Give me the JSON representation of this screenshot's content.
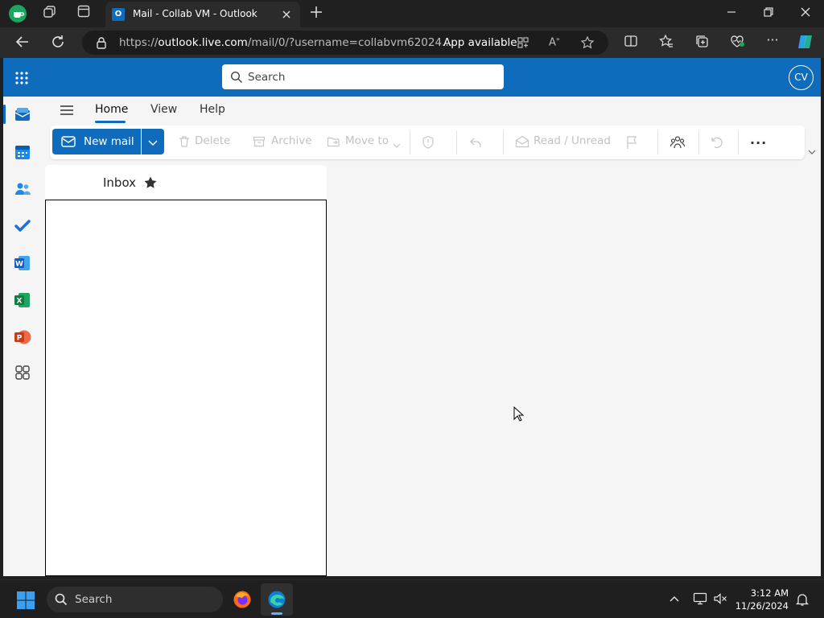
{
  "browser": {
    "tab_title": "Mail - Collab VM - Outlook",
    "url_prefix": "https://",
    "url_host": "outlook.live.com",
    "url_path": "/mail/0/?username=collabvm62024...",
    "app_available": "App available"
  },
  "outlook": {
    "search_placeholder": "Search",
    "avatar_initials": "CV",
    "ribbon_tabs": [
      "Home",
      "View",
      "Help"
    ],
    "toolbar": {
      "new_mail": "New mail",
      "delete": "Delete",
      "archive": "Archive",
      "move_to": "Move to",
      "read_unread": "Read / Unread",
      "more": "..."
    },
    "folder_title": "Inbox"
  },
  "taskbar": {
    "search_label": "Search",
    "time": "3:12 AM",
    "date": "11/26/2024"
  },
  "colors": {
    "accent": "#0f6cbd"
  }
}
